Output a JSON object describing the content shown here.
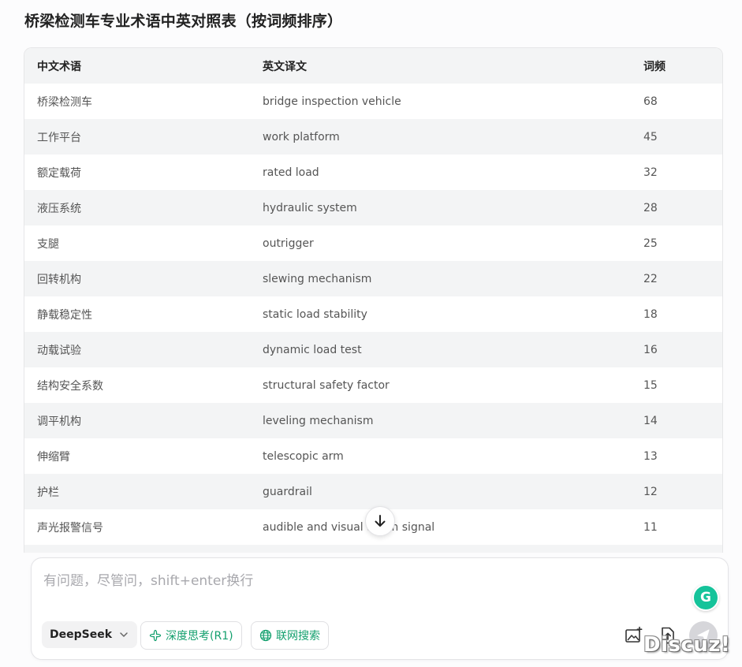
{
  "page": {
    "title": "桥梁检测车专业术语中英对照表（按词频排序）"
  },
  "table": {
    "headers": [
      "中文术语",
      "英文译文",
      "词频"
    ],
    "rows": [
      [
        "桥梁检测车",
        "bridge inspection vehicle",
        "68"
      ],
      [
        "工作平台",
        "work platform",
        "45"
      ],
      [
        "额定载荷",
        "rated load",
        "32"
      ],
      [
        "液压系统",
        "hydraulic system",
        "28"
      ],
      [
        "支腿",
        "outrigger",
        "25"
      ],
      [
        "回转机构",
        "slewing mechanism",
        "22"
      ],
      [
        "静载稳定性",
        "static load stability",
        "18"
      ],
      [
        "动载试验",
        "dynamic load test",
        "16"
      ],
      [
        "结构安全系数",
        "structural safety factor",
        "15"
      ],
      [
        "调平机构",
        "leveling mechanism",
        "14"
      ],
      [
        "伸缩臂",
        "telescopic arm",
        "13"
      ],
      [
        "护栏",
        "guardrail",
        "12"
      ],
      [
        "声光报警信号",
        "audible and visual alarm signal",
        "11"
      ],
      [
        "",
        "",
        ""
      ]
    ]
  },
  "composer": {
    "placeholder": "有问题，尽管问，shift+enter换行",
    "model_label": "DeepSeek",
    "deep_think_label": "深度思考(R1)",
    "web_search_label": "联网搜索",
    "grammarly_letter": "G"
  },
  "watermark": "Discuz!",
  "colors": {
    "accent_green": "#14a06e",
    "grammarly": "#15c39a",
    "send_disabled": "#d6d6da"
  },
  "icons": {
    "scroll": "arrow-down-icon",
    "model": "chevron-down-icon",
    "deep_think": "atom-icon",
    "web_search": "globe-icon",
    "image": "image-plus-icon",
    "upload": "file-upload-icon",
    "send": "send-icon"
  }
}
